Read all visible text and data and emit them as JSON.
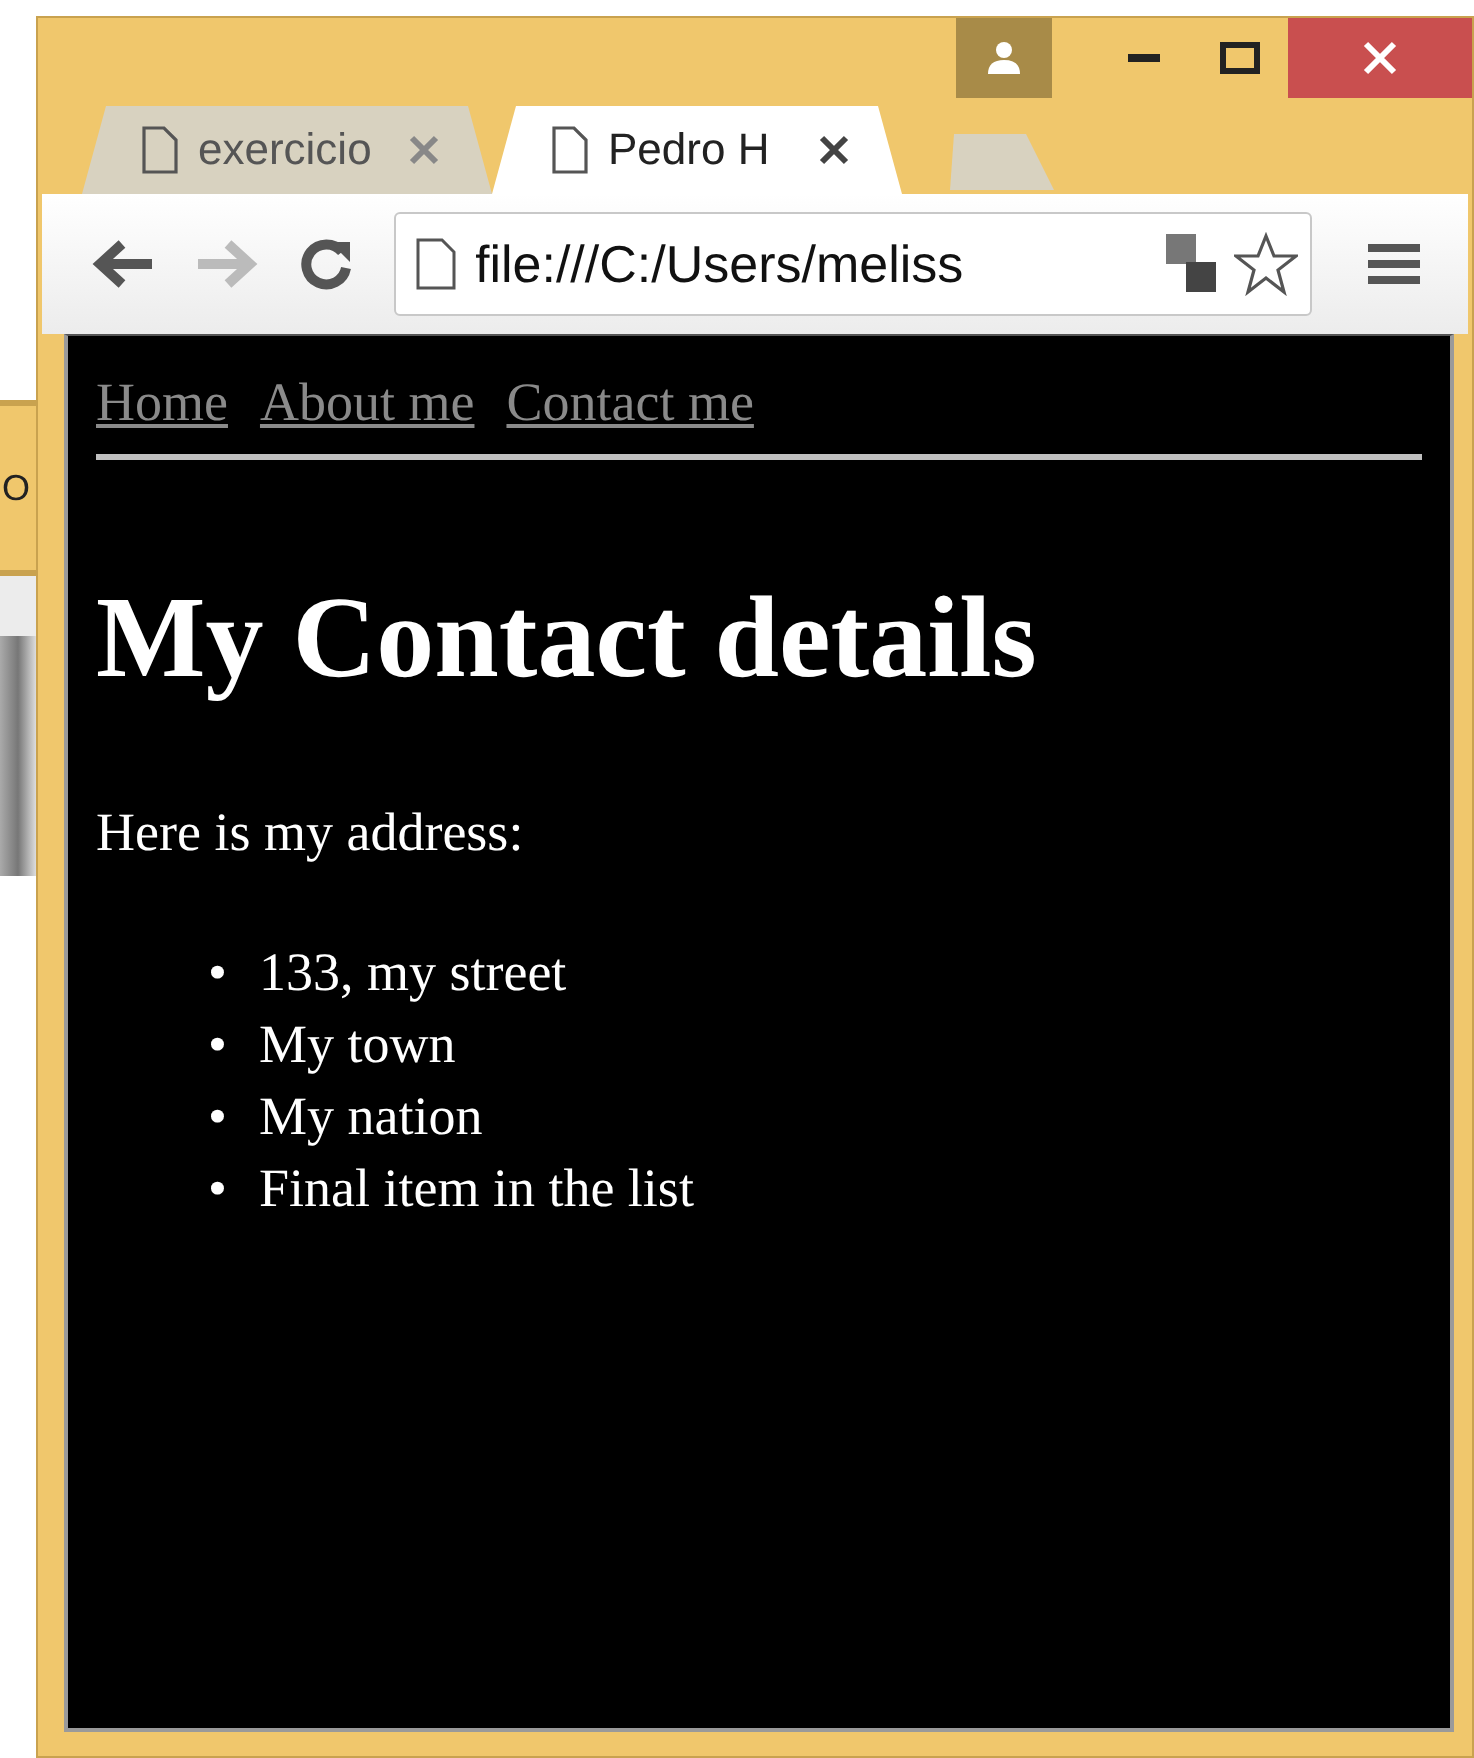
{
  "background_window": {
    "text": "O"
  },
  "tabs": [
    {
      "title": "exercicio",
      "selected": false
    },
    {
      "title": "Pedro H",
      "selected": true
    }
  ],
  "address_bar": {
    "value": "file:///C:/Users/meliss"
  },
  "page": {
    "nav_links": [
      "Home",
      "About me",
      "Contact me"
    ],
    "heading": "My Contact details",
    "paragraph": "Here is my address:",
    "list_items": [
      {
        "marker": "•",
        "text": "133, my street"
      },
      {
        "marker": "•",
        "text": "My town"
      },
      {
        "marker": "•",
        "text": "My nation"
      },
      {
        "marker": "•",
        "text": "Final item in the list"
      }
    ]
  }
}
